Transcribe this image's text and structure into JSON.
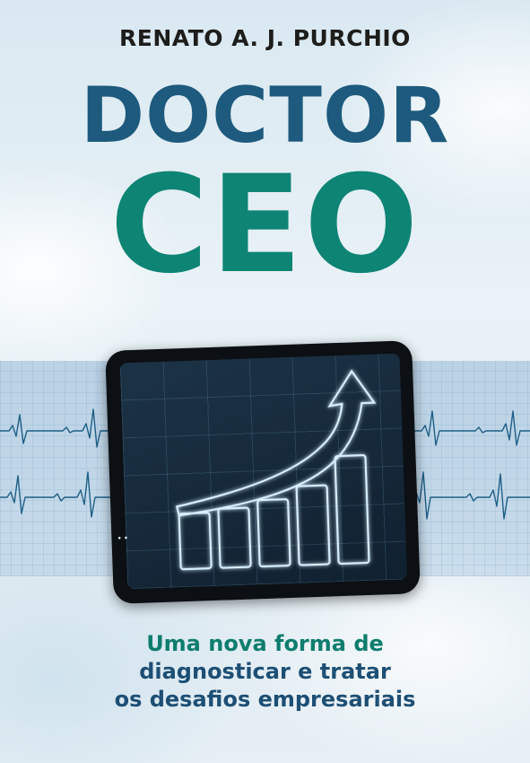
{
  "cover": {
    "author": "RENATO A. J. PURCHIO",
    "title_line1": "DOCTOR",
    "title_line2": "CEO",
    "subtitle_line1": "Uma nova forma de",
    "subtitle_line2": "diagnosticar e tratar",
    "subtitle_line3": "os desafios empresariais",
    "colors": {
      "author": "#1d1d1b",
      "title_line1": "#1d5a7d",
      "title_line2": "#0e8474",
      "subtitle_line1": "#0e7d6e",
      "subtitle_other": "#1d4f75",
      "tablet": "#0c1014",
      "glow": "#cfeaff"
    },
    "illustration": {
      "subject": "tablet showing rising bar chart with upward arrow over ECG heartbeat band",
      "bar_count": 5,
      "trend": "increasing"
    }
  }
}
